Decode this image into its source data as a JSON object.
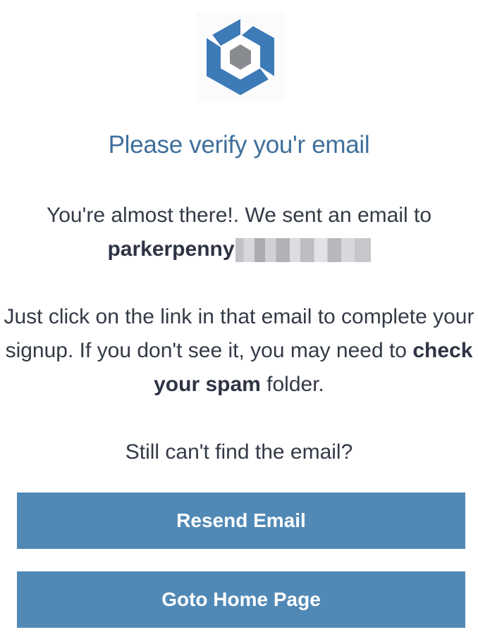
{
  "logo": {
    "icon": "hexagon-logo-icon",
    "colors": {
      "ring": "#3d7ab8",
      "core": "#888b8f"
    }
  },
  "title": "Please verify you'r email",
  "message": {
    "intro": "You're almost there!. We sent an email to",
    "email_visible": "parkerpenny",
    "instructions_before": "Just click on the link in that email to complete your signup. If you don't see it, you may need to ",
    "instructions_bold": "check your spam",
    "instructions_after": " folder.",
    "still": "Still can't find the email?"
  },
  "buttons": {
    "resend": "Resend Email",
    "home": "Goto Home Page"
  },
  "colors": {
    "title": "#3f6f9c",
    "button": "#5189b6",
    "text": "#333a46"
  }
}
